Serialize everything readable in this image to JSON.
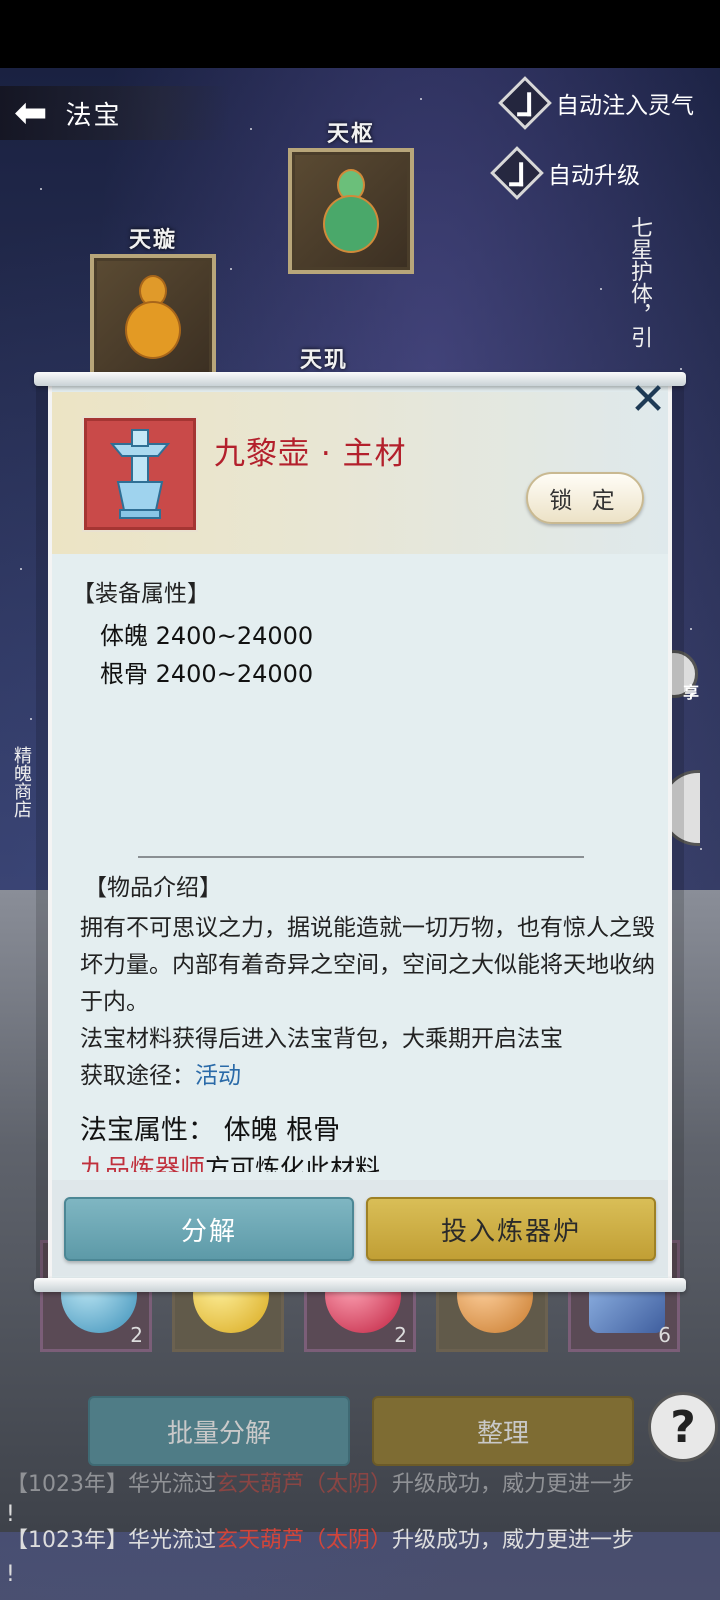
{
  "header": {
    "back_label": "法宝"
  },
  "toggles": [
    {
      "label": "自动注入灵气",
      "checked": true
    },
    {
      "label": "自动升级",
      "checked": true
    }
  ],
  "side": {
    "right_vertical": "七星护体，引",
    "left_vertical": "精魄商店",
    "share_label": "享"
  },
  "slots": [
    {
      "label": "天枢"
    },
    {
      "label": "天璇"
    },
    {
      "label": "天玑"
    }
  ],
  "modal": {
    "item_name": "九黎壶 · 主材",
    "lock_label": "锁 定",
    "equip_title": "【装备属性】",
    "equip_attrs": [
      "体魄 2400~24000",
      "根骨 2400~24000"
    ],
    "intro_title": "【物品介绍】",
    "intro_text": "拥有不可思议之力，据说能造就一切万物，也有惊人之毁坏力量。内部有着奇异之空间，空间之大似能将天地收纳于内。",
    "bag_note": "法宝材料获得后进入法宝背包，大乘期开启法宝",
    "source_prefix": "获取途径：",
    "source_link": "活动",
    "fabao_attr": "法宝属性：  体魄 根骨",
    "cut_red": "九品炼器师",
    "cut_rest": "方可炼化此材料",
    "btn_decompose": "分解",
    "btn_furnace": "投入炼器炉"
  },
  "bag": {
    "counts": [
      "2",
      "",
      "2",
      "",
      "6"
    ]
  },
  "bottom": {
    "batch_label": "批量分解",
    "sort_label": "整理",
    "help_label": "?"
  },
  "log": [
    {
      "prefix": "【1023年】华光流过",
      "red": "玄天葫芦（太阴）",
      "suffix": "升级成功，威力更进一步"
    }
  ],
  "log_tail": "!",
  "colors": {
    "accent_red": "#b3202c",
    "teal": "#5d9aa8",
    "gold": "#c19f35",
    "link_blue": "#2a6aa8"
  }
}
